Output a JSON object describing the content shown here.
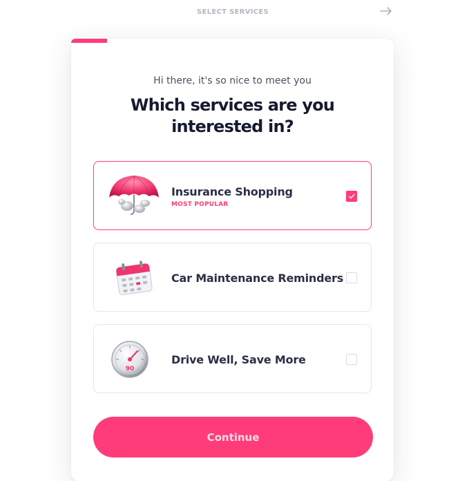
{
  "header": {
    "step_title": "SELECT SERVICES",
    "next_icon": "arrow-right-icon"
  },
  "card": {
    "greeting": "Hi there, it's so nice to meet you",
    "heading": "Which services are you interested in?",
    "accent_color": "#ff3c7a",
    "progress": 0.11
  },
  "options": [
    {
      "label": "Insurance Shopping",
      "tag": "MOST POPULAR",
      "icon": "umbrella-icon",
      "selected": true
    },
    {
      "label": "Car Maintenance Reminders",
      "icon": "calendar-icon",
      "selected": false
    },
    {
      "label": "Drive Well, Save More",
      "icon": "speedometer-icon",
      "selected": false
    }
  ],
  "actions": {
    "continue_label": "Continue"
  }
}
